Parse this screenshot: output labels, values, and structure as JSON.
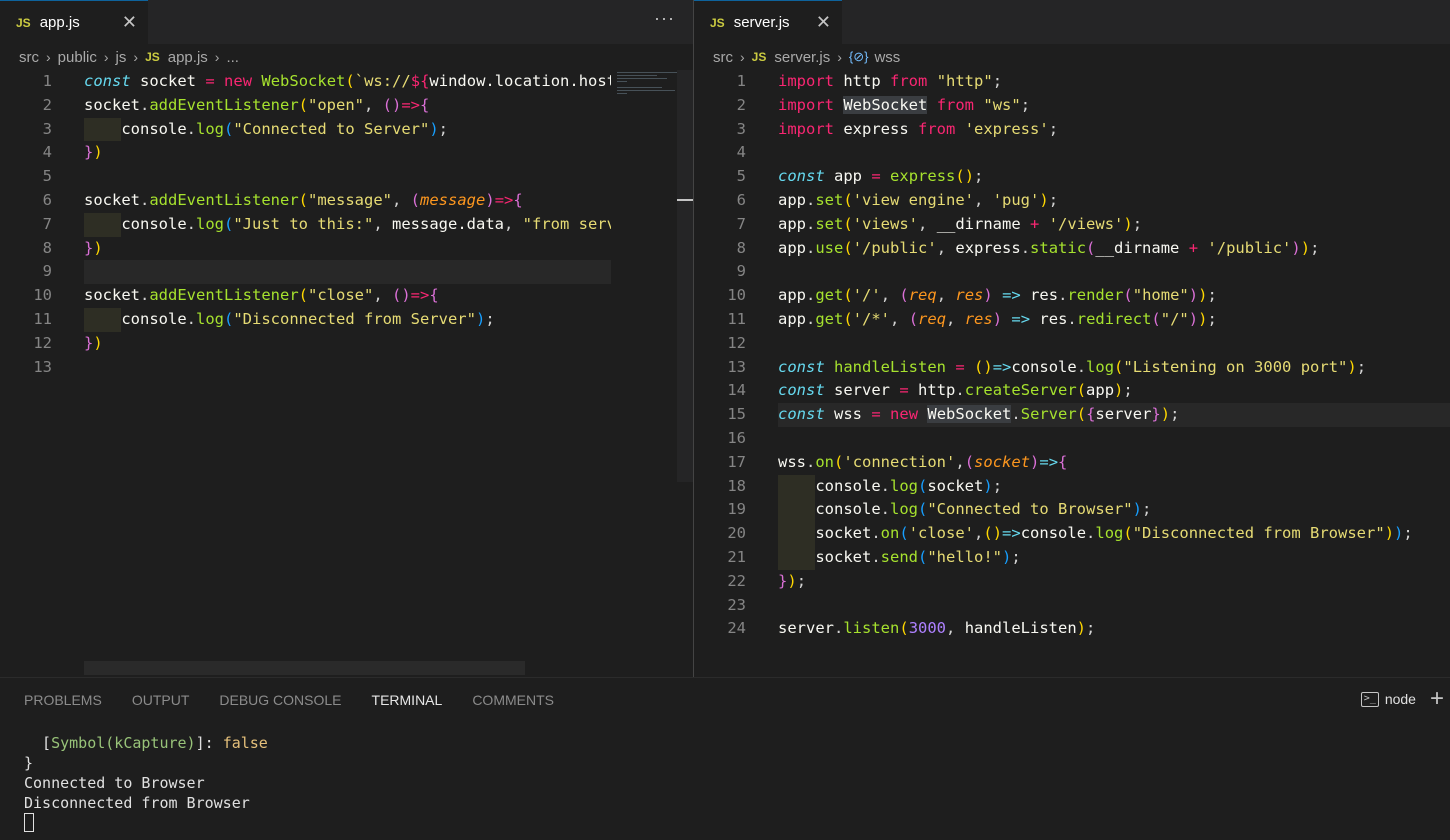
{
  "left_editor": {
    "tab": {
      "badge": "JS",
      "title": "app.js",
      "close": "✕"
    },
    "more_actions": "···",
    "breadcrumb": {
      "parts": [
        "src",
        "public",
        "js"
      ],
      "file_badge": "JS",
      "file": "app.js",
      "tail": "..."
    },
    "line_numbers": [
      "1",
      "2",
      "3",
      "4",
      "5",
      "6",
      "7",
      "8",
      "9",
      "10",
      "11",
      "12",
      "13"
    ],
    "code": [
      "const socket = new WebSocket(`ws://${window.location.host}`);",
      "socket.addEventListener(\"open\", ()=>{",
      "    console.log(\"Connected to Server\");",
      "})",
      "",
      "socket.addEventListener(\"message\", (message)=>{",
      "    console.log(\"Just to this:\", message.data, \"from server\");",
      "})",
      "",
      "socket.addEventListener(\"close\", ()=>{",
      "    console.log(\"Disconnected from Server\");",
      "})",
      ""
    ]
  },
  "right_editor": {
    "tab": {
      "badge": "JS",
      "title": "server.js",
      "close": "✕"
    },
    "breadcrumb": {
      "parts": [
        "src"
      ],
      "file_badge": "JS",
      "file": "server.js",
      "symbol_icon": "{⊘}",
      "symbol": "wss"
    },
    "line_numbers": [
      "1",
      "2",
      "3",
      "4",
      "5",
      "6",
      "7",
      "8",
      "9",
      "10",
      "11",
      "12",
      "13",
      "14",
      "15",
      "16",
      "17",
      "18",
      "19",
      "20",
      "21",
      "22",
      "23",
      "24"
    ]
  },
  "panel": {
    "tabs": [
      "PROBLEMS",
      "OUTPUT",
      "DEBUG CONSOLE",
      "TERMINAL",
      "COMMENTS"
    ],
    "active_tab": "TERMINAL",
    "shell_label": "node",
    "terminal_lines": {
      "l1_prefix": "  [",
      "l1_symbol": "Symbol(kCapture)",
      "l1_mid": "]: ",
      "l1_value": "false",
      "l2": "}",
      "l3": "Connected to Browser",
      "l4": "Disconnected from Browser"
    }
  },
  "colors": {
    "keyword": "#f92672",
    "string": "#e6db74",
    "function": "#a6e22e",
    "storage": "#66d9ef",
    "param": "#fd971f",
    "number": "#ae81ff"
  }
}
